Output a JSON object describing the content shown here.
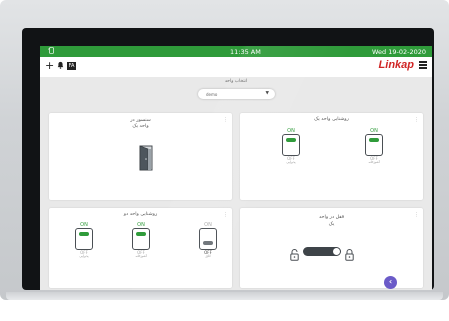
{
  "statusbar": {
    "time": "11:35 AM",
    "date": "Wed   19-02-2020",
    "left_icon": "screen-rotate-icon"
  },
  "appbar": {
    "lang_badge": "FA",
    "logo": "Linkap",
    "plus_icon": "plus-icon",
    "bell_icon": "bell-icon",
    "menu_icon": "hamburger-menu-icon"
  },
  "selector": {
    "label": "انتخاب واحد",
    "value": "demo"
  },
  "cards": {
    "sensor": {
      "title_line1": "سنسور در",
      "title_line2": "واحد یک",
      "icon": "open-door-icon"
    },
    "lights1": {
      "title": "روشنایی واحد یک",
      "switches": [
        {
          "on_label": "ON",
          "off_label": "OFF",
          "name": "پذیرایی",
          "state": "on"
        },
        {
          "on_label": "ON",
          "off_label": "OFF",
          "name": "آشپزخانه",
          "state": "on"
        }
      ]
    },
    "lights2": {
      "title": "روشنایی واحد دو",
      "switches": [
        {
          "on_label": "ON",
          "off_label": "OFF",
          "name": "پذیرایی",
          "state": "on"
        },
        {
          "on_label": "ON",
          "off_label": "OFF",
          "name": "آشپزخانه",
          "state": "on"
        },
        {
          "on_label": "ON",
          "off_label": "OFF",
          "name": "اتاق",
          "state": "off"
        }
      ]
    },
    "lock": {
      "title_line1": "قفل در واحد",
      "title_line2": "یک",
      "left_icon": "lock-open-icon",
      "right_icon": "lock-closed-icon"
    }
  },
  "fab_icon": "chevron-left-icon",
  "colors": {
    "accent": "#2f9b3a",
    "brand": "#d02525",
    "fab": "#6b5bc8",
    "off": "#6d7378"
  }
}
